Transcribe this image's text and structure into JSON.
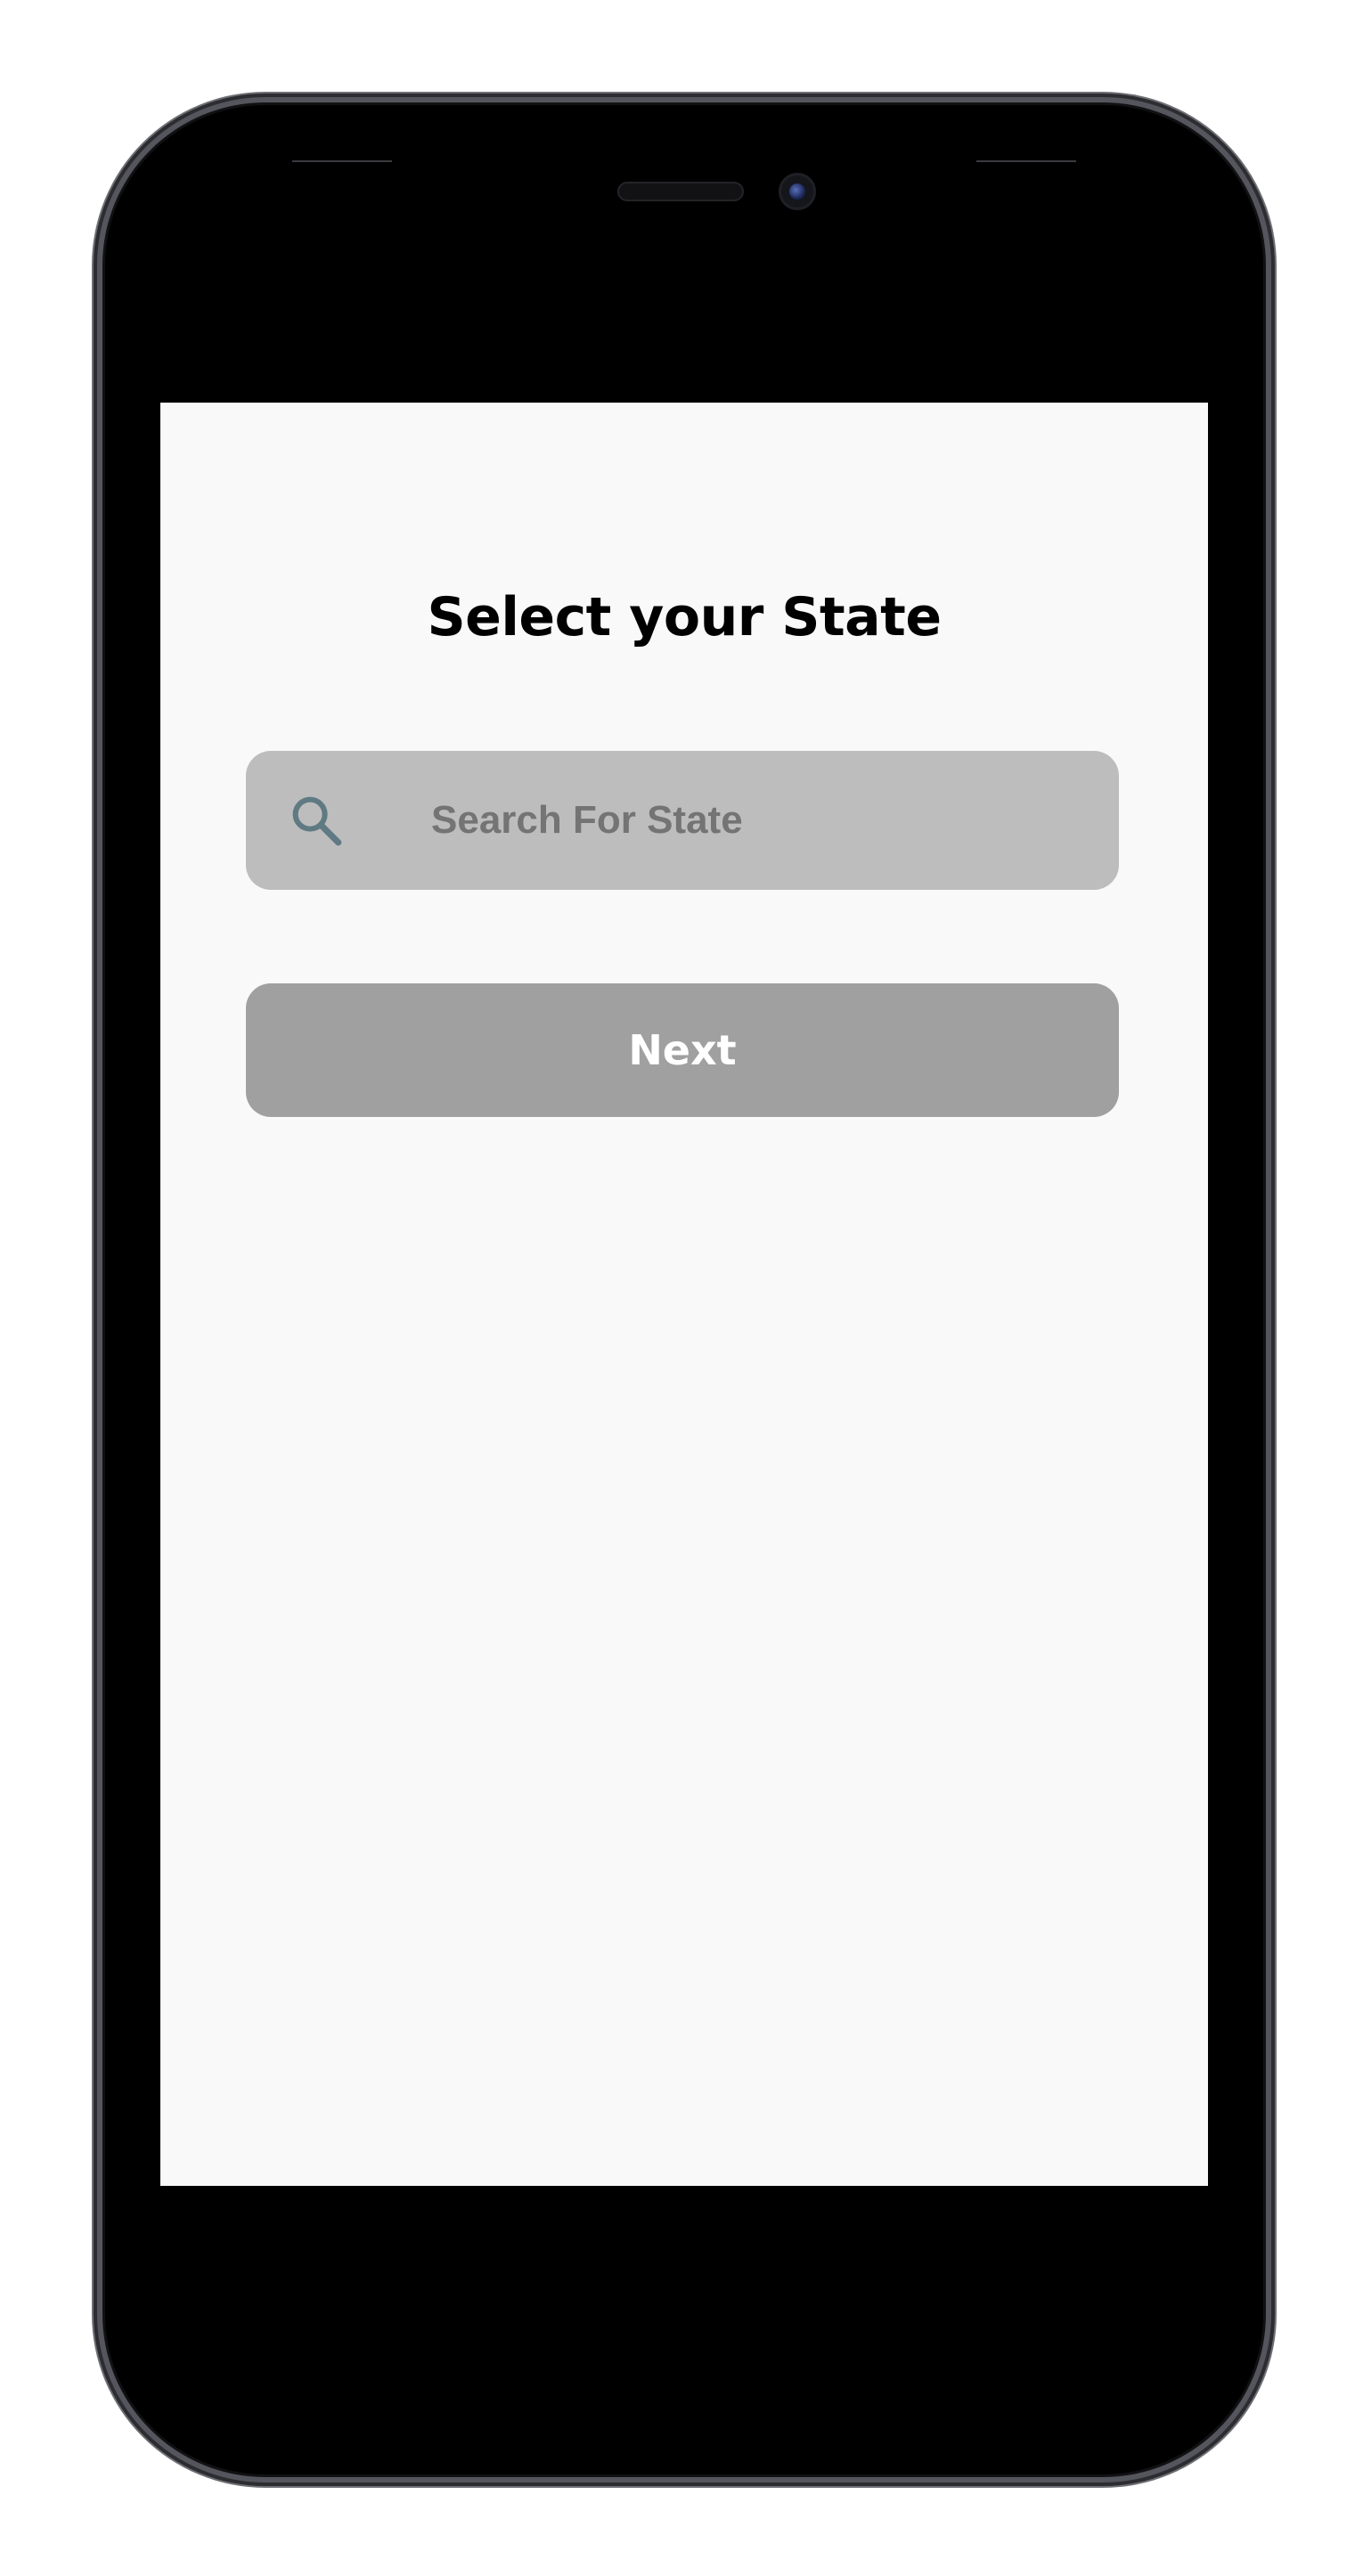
{
  "screen": {
    "title": "Select your State",
    "search": {
      "placeholder": "Search For State",
      "value": "",
      "icon": "search-icon"
    },
    "next_label": "Next"
  },
  "colors": {
    "screen_background": "#f9f9f9",
    "search_background": "#bdbdbd",
    "search_icon": "#5f7a82",
    "button_background": "#a0a0a0",
    "button_text": "#ffffff"
  }
}
